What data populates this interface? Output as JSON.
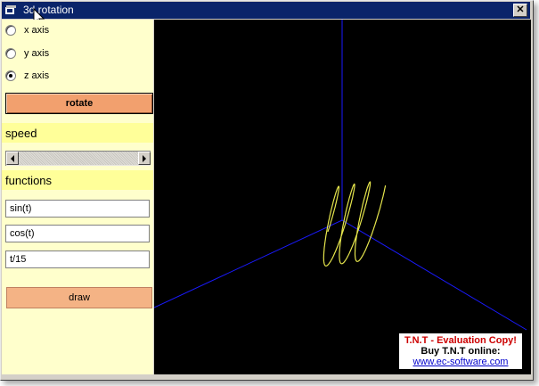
{
  "window": {
    "title": "3d rotation",
    "close_label": "✕"
  },
  "axis_options": [
    {
      "label": "x axis",
      "checked": false
    },
    {
      "label": "y axis",
      "checked": false
    },
    {
      "label": "z axis",
      "checked": true
    }
  ],
  "rotate_label": "rotate",
  "speed_label": "speed",
  "functions_label": "functions",
  "functions": [
    "sin(t)",
    "cos(t)",
    "t/15"
  ],
  "draw_label": "draw",
  "evaluation": {
    "line1": "T.N.T - Evaluation Copy!",
    "line2": "Buy T.N.T online:",
    "link": "www.ec-software.com"
  },
  "colors": {
    "axes": "#1a1aff",
    "curve": "#e6e64d",
    "panel": "#ffffcc",
    "button": "#f2a06e"
  }
}
